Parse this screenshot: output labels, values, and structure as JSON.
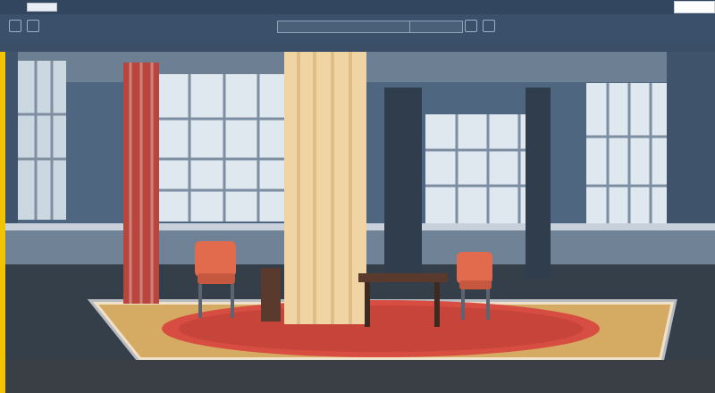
{
  "window": {
    "title": ""
  },
  "topbar": {
    "menu": [
      "",
      "",
      "",
      "",
      "",
      ""
    ],
    "right_text": "",
    "right_box": ""
  },
  "toolbar": {
    "labels": [
      "",
      "",
      "",
      ""
    ],
    "search_value": "",
    "search_value_2": ""
  },
  "subbar": {
    "items": [
      "",
      "",
      "",
      "",
      ""
    ]
  },
  "colors": {
    "chrome": "#33465f",
    "toolbar": "#3b506b",
    "accent": "#f2c400"
  },
  "scene": {
    "description": "",
    "elements": [
      "curtain-red",
      "curtain-cream",
      "curtain-dark-left",
      "curtain-dark-right",
      "chair-orange-left",
      "chair-orange-right",
      "table",
      "red-rug",
      "windows"
    ]
  }
}
